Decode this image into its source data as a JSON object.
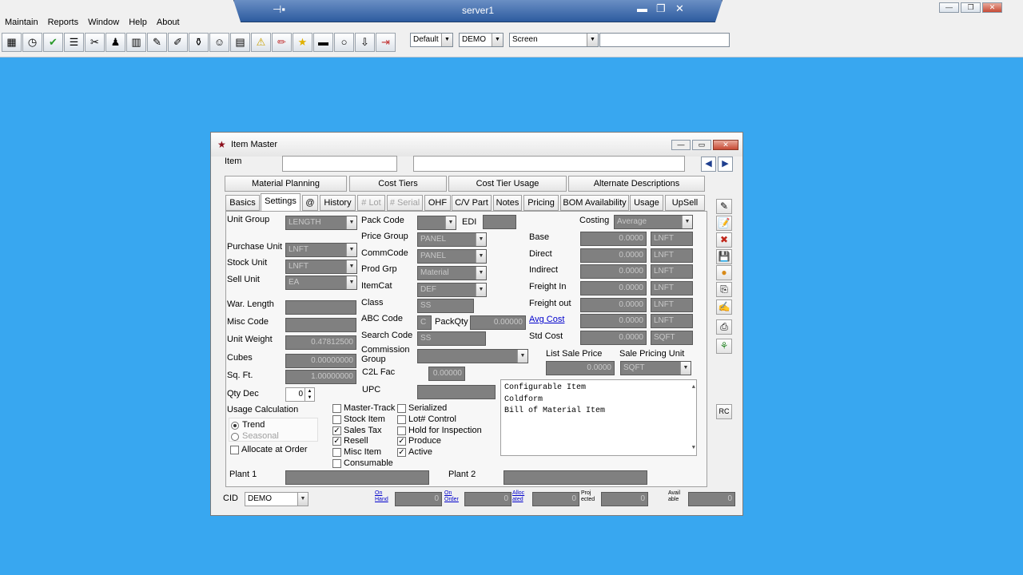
{
  "rdp": {
    "title": "server1"
  },
  "menu": [
    "Maintain",
    "Reports",
    "Window",
    "Help",
    "About"
  ],
  "toolbar_icons": [
    "calendar-icon",
    "clock-icon",
    "check-icon",
    "list-icon",
    "tools-icon",
    "user-icon",
    "chart-icon",
    "edit-icon",
    "edit2-icon",
    "jar-icon",
    "chat-icon",
    "notepad-icon",
    "warning-icon",
    "pencil-icon",
    "star-icon",
    "folder-icon",
    "disc-icon",
    "download-icon",
    "exit-icon"
  ],
  "toolbar": {
    "layout": "Default",
    "company": "DEMO",
    "view": "Screen"
  },
  "window": {
    "title": "Item Master",
    "item_label": "Item",
    "item_value": "",
    "desc_value": ""
  },
  "tabs_top": [
    "Material Planning",
    "Cost Tiers",
    "Cost Tier Usage",
    "Alternate Descriptions"
  ],
  "tabs": [
    "Basics",
    "Settings",
    "@",
    "History",
    "# Lot",
    "# Serial",
    "OHF",
    "C/V Part",
    "Notes",
    "Pricing",
    "BOM Availability",
    "Usage",
    "UpSell"
  ],
  "active_tab": "Settings",
  "left": {
    "unit_group_label": "Unit Group",
    "unit_group": "LENGTH",
    "purchase_unit_label": "Purchase Unit",
    "purchase_unit": "LNFT",
    "stock_unit_label": "Stock Unit",
    "stock_unit": "LNFT",
    "sell_unit_label": "Sell Unit",
    "sell_unit": "EA",
    "war_length_label": "War. Length",
    "misc_code_label": "Misc Code",
    "unit_weight_label": "Unit Weight",
    "unit_weight": "0.47812500",
    "cubes_label": "Cubes",
    "cubes": "0.00000000",
    "sqft_label": "Sq. Ft.",
    "sqft": "1.00000000",
    "qty_dec_label": "Qty Dec",
    "qty_dec": "0",
    "usage_calc_label": "Usage Calculation",
    "trend": "Trend",
    "seasonal": "Seasonal",
    "allocate": "Allocate at Order"
  },
  "mid": {
    "pack_code_label": "Pack Code",
    "edi_label": "EDI",
    "price_group_label": "Price Group",
    "price_group": "PANEL",
    "comm_code_label": "CommCode",
    "comm_code": "PANEL",
    "prod_grp_label": "Prod Grp",
    "prod_grp": "Material",
    "item_cat_label": "ItemCat",
    "item_cat": "DEF",
    "class_label": "Class",
    "class_value": "SS",
    "abc_label": "ABC Code",
    "abc_value": "C",
    "pack_qty_label": "PackQty",
    "pack_qty": "0.00000",
    "search_code_label": "Search Code",
    "search_code": "SS",
    "commission_label": "Commission Group",
    "c2l_label": "C2L Fac",
    "c2l": "0.00000",
    "upc_label": "UPC"
  },
  "checks_a": [
    {
      "label": "Master-Track",
      "on": false
    },
    {
      "label": "Stock Item",
      "on": false
    },
    {
      "label": "Sales Tax",
      "on": true
    },
    {
      "label": "Resell",
      "on": true
    },
    {
      "label": "Misc Item",
      "on": false
    },
    {
      "label": "Consumable",
      "on": false
    }
  ],
  "checks_b": [
    {
      "label": "Serialized",
      "on": false
    },
    {
      "label": "Lot# Control",
      "on": false
    },
    {
      "label": "Hold for Inspection",
      "on": false
    },
    {
      "label": "Produce",
      "on": true
    },
    {
      "label": "Active",
      "on": true
    }
  ],
  "costing": {
    "label": "Costing",
    "method": "Average",
    "rows": [
      {
        "label": "Base",
        "value": "0.0000",
        "unit": "LNFT"
      },
      {
        "label": "Direct",
        "value": "0.0000",
        "unit": "LNFT"
      },
      {
        "label": "Indirect",
        "value": "0.0000",
        "unit": "LNFT"
      },
      {
        "label": "Freight In",
        "value": "0.0000",
        "unit": "LNFT"
      },
      {
        "label": "Freight out",
        "value": "0.0000",
        "unit": "LNFT"
      },
      {
        "label": "Avg Cost",
        "value": "0.0000",
        "unit": "LNFT"
      },
      {
        "label": "Std Cost",
        "value": "0.0000",
        "unit": "SQFT"
      }
    ],
    "list_price_label": "List Sale Price",
    "list_price": "0.0000",
    "pricing_unit_label": "Sale Pricing Unit",
    "pricing_unit": "SQFT"
  },
  "notes_lines": [
    "Configurable Item",
    "Coldform",
    "Bill of Material Item"
  ],
  "plant1_label": "Plant 1",
  "plant2_label": "Plant 2",
  "footer": {
    "cid_label": "CID",
    "cid": "DEMO",
    "stocks": [
      {
        "l1": "On",
        "l2": "Hand",
        "v": "0",
        "link": true
      },
      {
        "l1": "On",
        "l2": "Order",
        "v": "0",
        "link": true
      },
      {
        "l1": "Alloc",
        "l2": "ated",
        "v": "0",
        "link": true
      },
      {
        "l1": "Proj",
        "l2": "ected",
        "v": "0",
        "link": false
      },
      {
        "l1": "Avail",
        "l2": "able",
        "v": "0",
        "link": false
      }
    ]
  },
  "rc_label": "RC"
}
